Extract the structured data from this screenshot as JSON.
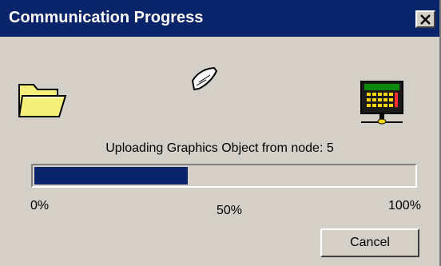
{
  "window": {
    "title": "Communication Progress",
    "close_icon": "close-icon"
  },
  "icons": {
    "source": "folder-icon",
    "transfer": "document-icon",
    "target": "terminal-device-icon"
  },
  "status": {
    "message": "Uploading Graphics Object from node: 5"
  },
  "progress": {
    "value_percent": 40,
    "labels": {
      "min": "0%",
      "mid": "50%",
      "max": "100%"
    }
  },
  "buttons": {
    "cancel_label": "Cancel"
  },
  "colors": {
    "titlebar": "#0a246a",
    "progress_fill": "#0a246a",
    "dialog_face": "#d4d0c8",
    "folder": "#f5f07a",
    "screen": "#0a8a0a",
    "keys": "#ffd800"
  }
}
